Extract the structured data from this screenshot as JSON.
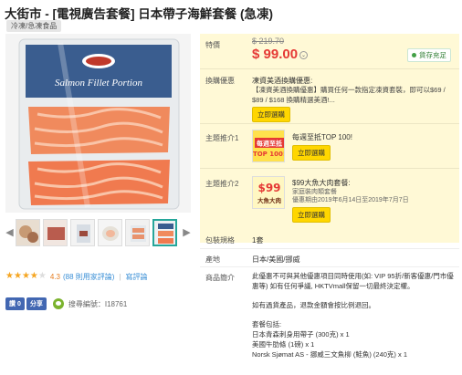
{
  "product": {
    "title": "大街市 - [電視廣告套餐] 日本帶子海鮮套餐 (急凍)",
    "category": "冷凍/急凍食品",
    "image_caption": "Salmon Fillet Portion"
  },
  "rating": {
    "stars": 4.3,
    "score_text": "4.3",
    "count_text": "(88 則用家評論)",
    "write_link": "寫評論"
  },
  "social": {
    "like_label": "讚 0",
    "share_label": "分享",
    "search_code": "搜尋編號：I18761"
  },
  "pricing": {
    "label": "特價",
    "original_price": "$ 219.70",
    "price": "$ 99.00",
    "stock_status": "貨存充足"
  },
  "promo": {
    "label": "換購優惠",
    "title": "凍資美酒換購優惠:",
    "desc": "【凍資美酒換購優惠】購買任何一款指定凍資套裝，即可以$69 / $89 / $168 換購精選美酒!...",
    "button": "立即選購"
  },
  "recommend1": {
    "label": "主題推介1",
    "title": "每週至抵TOP 100!",
    "img_text1": "每週至抵",
    "img_text2": "TOP 100!",
    "button": "立即選購"
  },
  "recommend2": {
    "label": "主題推介2",
    "title": "$99大魚大肉套餐:",
    "line1": "家庭裝肉類套餐",
    "line2": "優惠期由2019年6月14日至2019年7月7日",
    "img_text1": "$99",
    "img_text2": "大魚大肉",
    "button": "立即選購"
  },
  "info": {
    "pack_label": "包裝規格",
    "pack_value": "1套",
    "origin_label": "產地",
    "origin_value": "日本/美國/挪威",
    "desc_label": "商品簡介",
    "desc_p1": "此優惠不可與其他優惠項目同時使用(如: VIP 95折/新客優惠/門市優惠等) 如有任何爭議, HKTVmall保留一切最終決定權。",
    "desc_p2": "如有過貨產品，退款金額會按比例退回。",
    "items_title": "套餐包括:",
    "items": [
      "日本青森刺身用帶子 (300克) x 1",
      "美國牛肋條 (1磅) x 1",
      "Norsk Sjømat AS - 挪威三文魚柳 (鮭魚) (240克) x 1"
    ]
  },
  "colors": {
    "price_red": "#e53935",
    "panel_yellow": "#fff9d6",
    "button_yellow": "#ffd600",
    "stock_green": "#43a047",
    "link_blue": "#3a8fd6"
  }
}
